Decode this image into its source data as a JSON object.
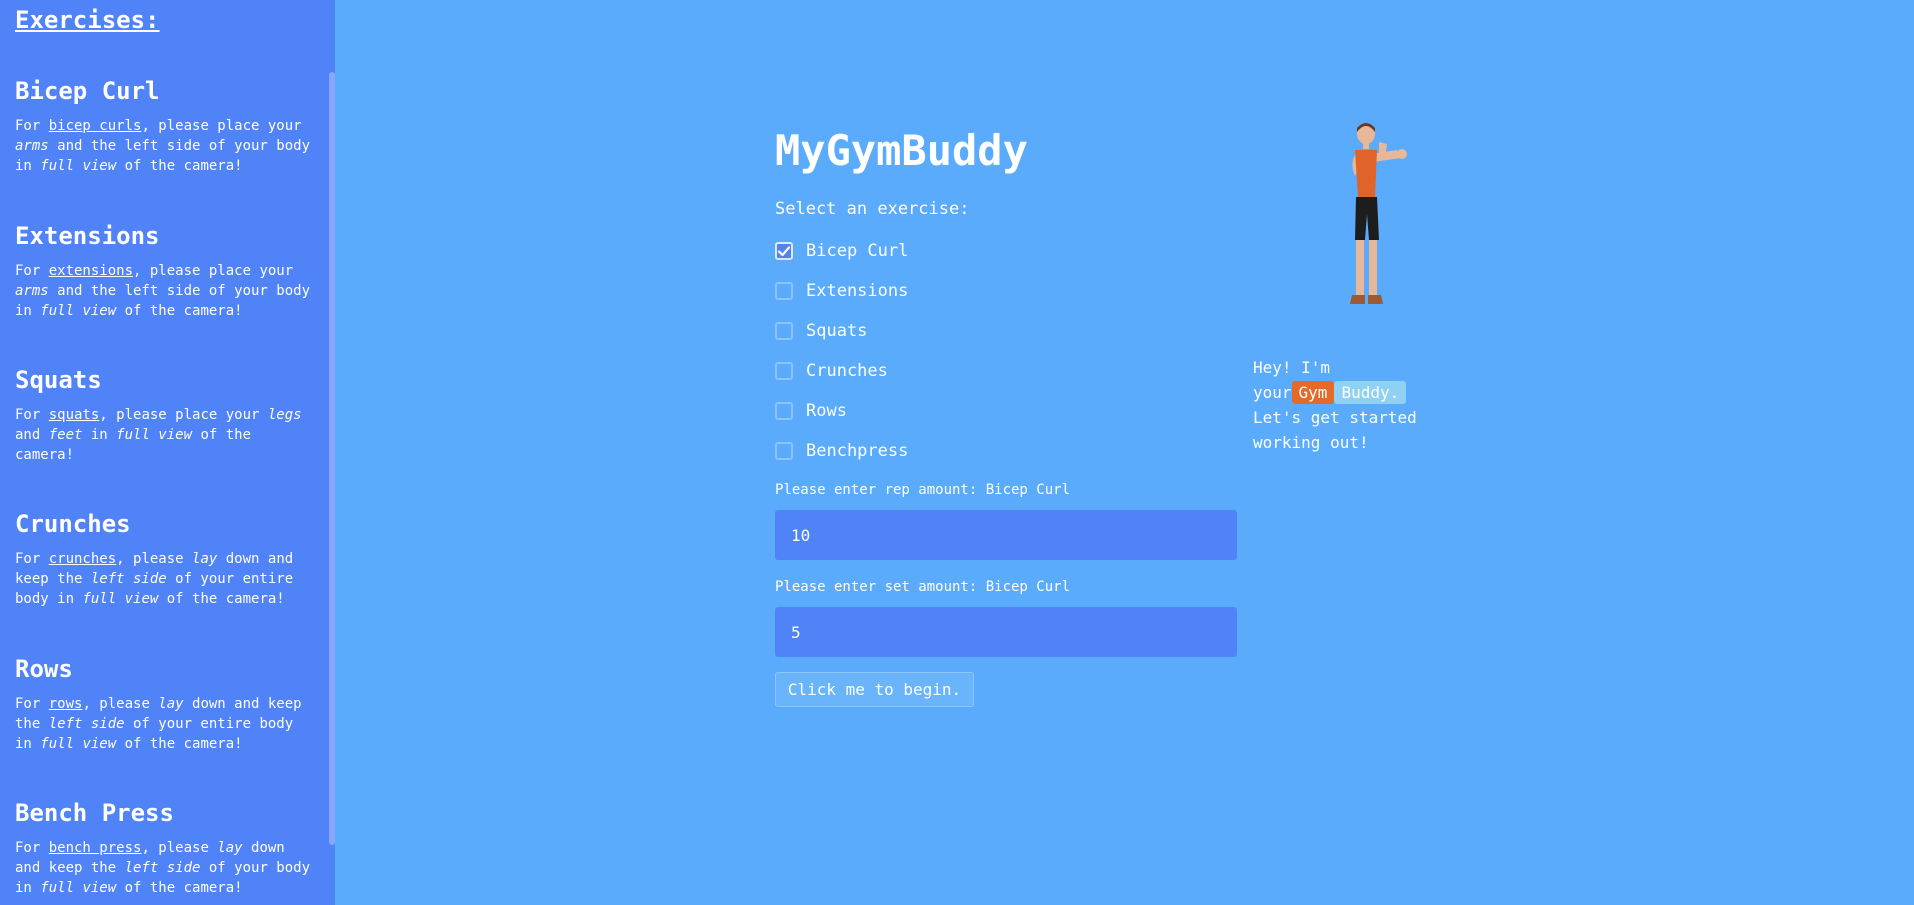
{
  "sidebar": {
    "title": "Exercises:",
    "exercises": [
      {
        "name": "Bicep Curl",
        "d": [
          "For ",
          "bicep curls",
          ", please place your ",
          "arms",
          " and the left side of your body in ",
          "full view",
          " of the camera!"
        ]
      },
      {
        "name": "Extensions",
        "d": [
          "For ",
          "extensions",
          ", please place your ",
          "arms",
          " and the left side of your body in ",
          "full view",
          " of the camera!"
        ]
      },
      {
        "name": "Squats",
        "d": [
          "For ",
          "squats",
          ", please place your ",
          "legs",
          " and ",
          "feet",
          " in ",
          "full view",
          " of the camera!"
        ]
      },
      {
        "name": "Crunches",
        "d": [
          "For ",
          "crunches",
          ", please ",
          "lay",
          " down and keep the ",
          "left side",
          " of your entire body in ",
          "full view",
          " of the camera!"
        ]
      },
      {
        "name": "Rows",
        "d": [
          "For ",
          "rows",
          ", please ",
          "lay",
          " down and keep the ",
          "left side",
          " of your entire body in ",
          "full view",
          " of the camera!"
        ]
      },
      {
        "name": "Bench Press",
        "d": [
          "For ",
          "bench press",
          ", please ",
          "lay",
          " down and keep the ",
          "left side",
          " of your body in ",
          "full view",
          " of the camera!"
        ]
      }
    ]
  },
  "main": {
    "title": "MyGymBuddy",
    "prompt": "Select an exercise:",
    "options": [
      {
        "label": "Bicep Curl",
        "checked": true
      },
      {
        "label": "Extensions",
        "checked": false
      },
      {
        "label": "Squats",
        "checked": false
      },
      {
        "label": "Crunches",
        "checked": false
      },
      {
        "label": "Rows",
        "checked": false
      },
      {
        "label": "Benchpress",
        "checked": false
      }
    ],
    "rep_label": "Please enter rep amount: Bicep Curl",
    "rep_value": "10",
    "set_label": "Please enter set amount: Bicep Curl",
    "set_value": "5",
    "begin_label": "Click me to begin."
  },
  "buddy": {
    "line1": "Hey! I'm",
    "your": "your",
    "gym": "Gym",
    "buddy_word": "Buddy.",
    "line3": "Let's get started working out!"
  },
  "colors": {
    "page_bg": "#5aabfb",
    "sidebar_bg": "#5083f8",
    "input_bg": "#5083f8",
    "gym_tag": "#e56a2a",
    "buddy_tag": "#8ed1f3"
  }
}
